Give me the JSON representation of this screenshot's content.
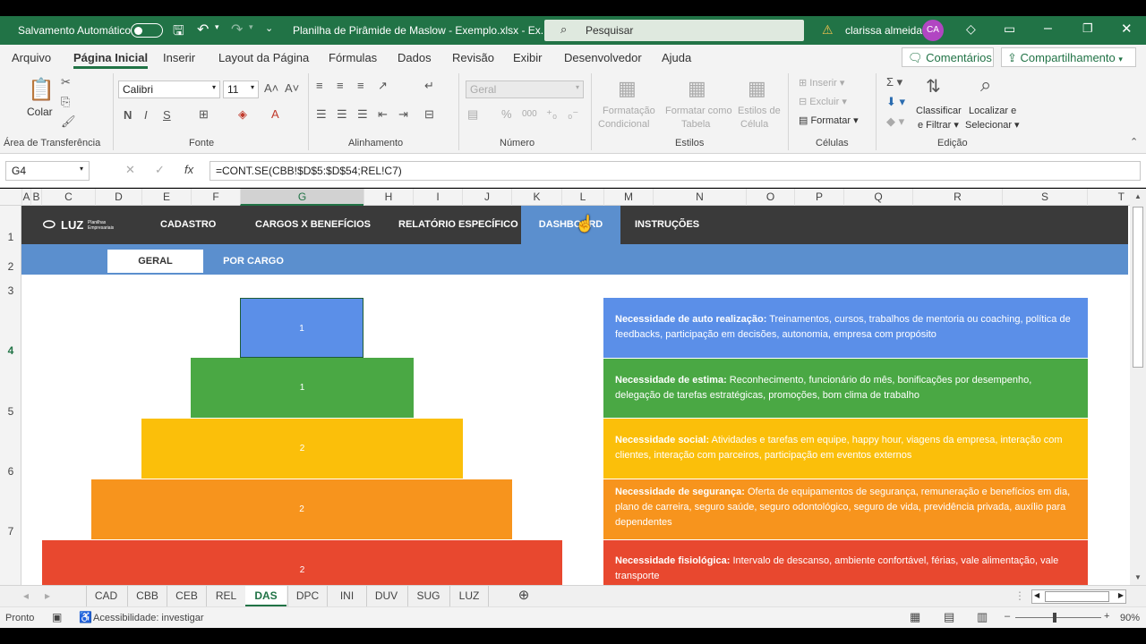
{
  "titlebar": {
    "autosave": "Salvamento Automático",
    "filename": "Planilha de Pirâmide de Maslow - Exemplo.xlsx  -  Ex...",
    "search_placeholder": "Pesquisar",
    "user": "clarissa almeida",
    "initials": "CA"
  },
  "menu": {
    "items": [
      "Arquivo",
      "Página Inicial",
      "Inserir",
      "Layout da Página",
      "Fórmulas",
      "Dados",
      "Revisão",
      "Exibir",
      "Desenvolvedor",
      "Ajuda"
    ],
    "comments": "Comentários",
    "share": "Compartilhamento"
  },
  "ribbon": {
    "paste": "Colar",
    "clipboard_group": "Área de Transferência",
    "font_name": "Calibri",
    "font_size": "11",
    "bold": "N",
    "italic": "I",
    "underline": "S",
    "font_group": "Fonte",
    "alignment_group": "Alinhamento",
    "number_format": "Geral",
    "number_group": "Número",
    "cond_format_1": "Formatação",
    "cond_format_2": "Condicional",
    "format_table_1": "Formatar como",
    "format_table_2": "Tabela",
    "cell_styles_1": "Estilos de",
    "cell_styles_2": "Célula",
    "styles_group": "Estilos",
    "insert": "Inserir",
    "delete": "Excluir",
    "format": "Formatar",
    "cells_group": "Células",
    "sort_1": "Classificar",
    "sort_2": "e Filtrar",
    "find_1": "Localizar e",
    "find_2": "Selecionar",
    "editing_group": "Edição"
  },
  "formula_bar": {
    "cell": "G4",
    "formula": "=CONT.SE(CBB!$D$5:$D$54;REL!C7)"
  },
  "columns": [
    "A",
    "B",
    "C",
    "D",
    "E",
    "F",
    "G",
    "H",
    "I",
    "J",
    "K",
    "L",
    "M",
    "N",
    "O",
    "P",
    "Q",
    "R",
    "S",
    "T"
  ],
  "rows": [
    "1",
    "2",
    "3",
    "4",
    "5",
    "6",
    "7"
  ],
  "sheet": {
    "logo": "LUZ",
    "logo_sub": "Planilhas Empresariais",
    "nav": [
      "CADASTRO",
      "CARGOS X BENEFÍCIOS",
      "RELATÓRIO ESPECÍFICO",
      "DASHBOARD",
      "INSTRUÇÕES"
    ],
    "subtabs": [
      "GERAL",
      "POR CARGO"
    ],
    "pyramid": [
      {
        "value": "1",
        "color": "#5b8fe8"
      },
      {
        "value": "1",
        "color": "#4aa844"
      },
      {
        "value": "2",
        "color": "#fbbf0a"
      },
      {
        "value": "2",
        "color": "#f7941d"
      },
      {
        "value": "2",
        "color": "#e8482f"
      }
    ],
    "needs": [
      {
        "title": "Necessidade de auto realização:",
        "text": " Treinamentos, cursos, trabalhos de mentoria ou coaching, política de feedbacks, participação em decisões, autonomia, empresa com propósito",
        "color": "#5b8fe8"
      },
      {
        "title": "Necessidade de estima:",
        "text": " Reconhecimento, funcionário do mês, bonificações por desempenho, delegação de tarefas estratégicas, promoções, bom clima de trabalho",
        "color": "#4aa844"
      },
      {
        "title": "Necessidade social:",
        "text": " Atividades e tarefas em equipe, happy hour, viagens da empresa, interação com clientes, interação com parceiros, participação em eventos externos",
        "color": "#fbbf0a"
      },
      {
        "title": "Necessidade de segurança:",
        "text": " Oferta de equipamentos de segurança, remuneração e benefícios em dia, plano de carreira, seguro saúde, seguro odontológico, seguro de vida, previdência privada, auxílio para dependentes",
        "color": "#f7941d"
      },
      {
        "title": "Necessidade fisiológica:",
        "text": " Intervalo de descanso, ambiente confortável, férias, vale alimentação, vale transporte",
        "color": "#e8482f"
      }
    ]
  },
  "tabs": [
    "CAD",
    "CBB",
    "CEB",
    "REL",
    "DAS",
    "DPC",
    "INI",
    "DUV",
    "SUG",
    "LUZ"
  ],
  "status": {
    "ready": "Pronto",
    "accessibility": "Acessibilidade: investigar",
    "zoom": "90%"
  }
}
